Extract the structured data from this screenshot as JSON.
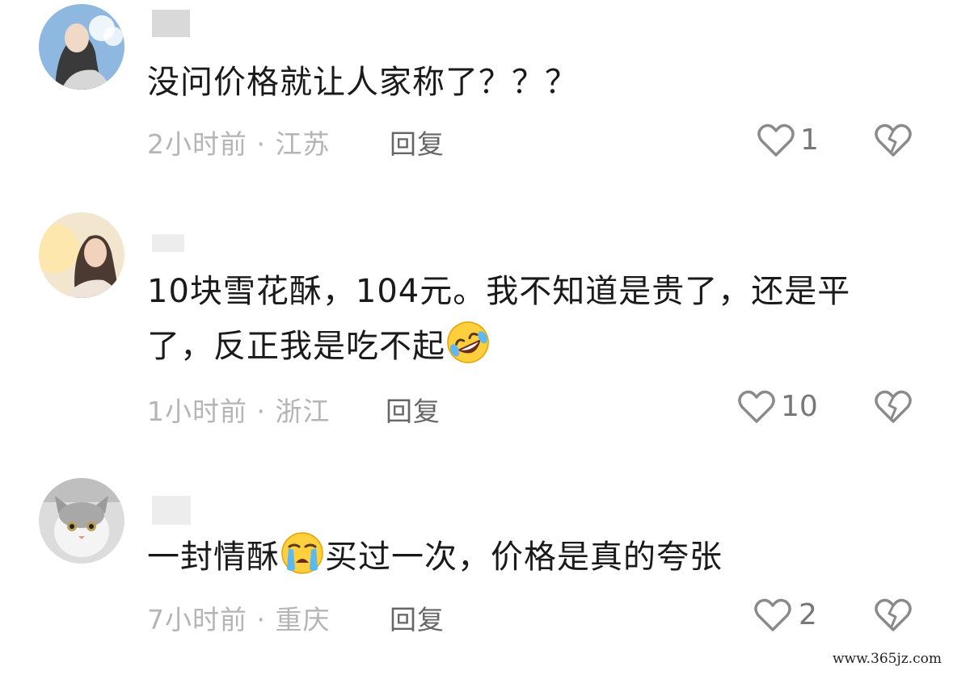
{
  "comments": [
    {
      "text": "没问价格就让人家称了？？？",
      "time": "2小时前",
      "location": "江苏",
      "reply_label": "回复",
      "likes": "1",
      "avatar_icon": "avatar-woman-sky"
    },
    {
      "text_line1": "10块雪花酥，104元。我不知道是贵了，还是平",
      "text_line2": "了，反正我是吃不起",
      "emoji": "rolling-on-floor-laughing-emoji",
      "time": "1小时前",
      "location": "浙江",
      "reply_label": "回复",
      "likes": "10",
      "avatar_icon": "avatar-woman-warm"
    },
    {
      "text_prefix": "一封情酥",
      "emoji": "crying-face-emoji",
      "text_suffix": "买过一次，价格是真的夸张",
      "time": "7小时前",
      "location": "重庆",
      "reply_label": "回复",
      "likes": "2",
      "avatar_icon": "avatar-cat"
    }
  ],
  "meta_separator": " · ",
  "watermark": "www.365jz.com",
  "colors": {
    "text": "#1a1a1a",
    "meta": "#b5b5b5",
    "icon": "#8a8a8a"
  }
}
